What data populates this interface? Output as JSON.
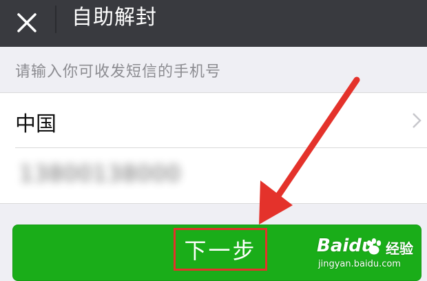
{
  "header": {
    "title": "自助解封",
    "close_icon": "close-icon",
    "background": "#393a3f"
  },
  "form": {
    "hint": "请输入你可收发短信的手机号",
    "country": {
      "label": "中国",
      "icon": "chevron-right-icon"
    },
    "phone": {
      "value": "13800138000",
      "obscured": true
    }
  },
  "next_button": {
    "label": "下一步",
    "color": "#1aad19"
  },
  "annotation": {
    "arrow_color": "#e4322b",
    "highlight_color": "#e4322b"
  },
  "watermark": {
    "brand": "Baidu",
    "cn": "经验",
    "url": "jingyan.baidu.com"
  }
}
